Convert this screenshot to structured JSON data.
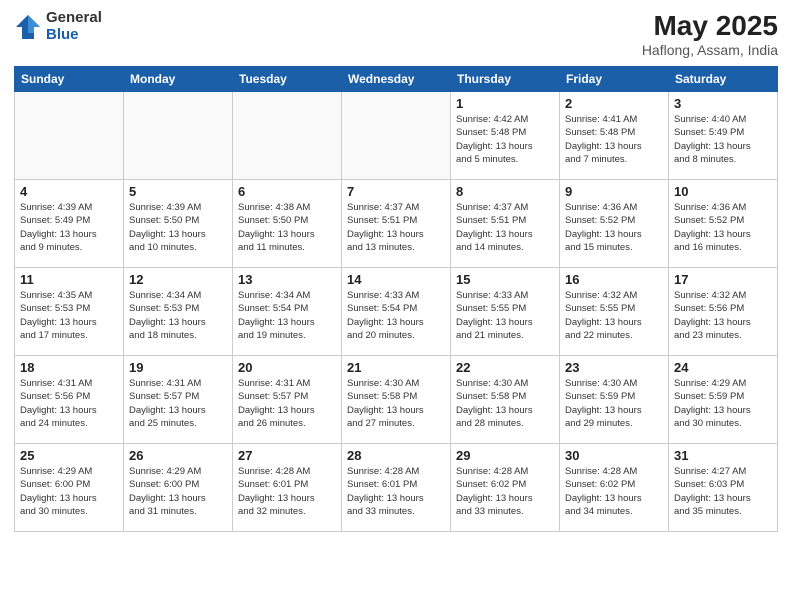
{
  "header": {
    "logo_general": "General",
    "logo_blue": "Blue",
    "title": "May 2025",
    "location": "Haflong, Assam, India"
  },
  "days_of_week": [
    "Sunday",
    "Monday",
    "Tuesday",
    "Wednesday",
    "Thursday",
    "Friday",
    "Saturday"
  ],
  "weeks": [
    [
      {
        "day": "",
        "info": ""
      },
      {
        "day": "",
        "info": ""
      },
      {
        "day": "",
        "info": ""
      },
      {
        "day": "",
        "info": ""
      },
      {
        "day": "1",
        "info": "Sunrise: 4:42 AM\nSunset: 5:48 PM\nDaylight: 13 hours\nand 5 minutes."
      },
      {
        "day": "2",
        "info": "Sunrise: 4:41 AM\nSunset: 5:48 PM\nDaylight: 13 hours\nand 7 minutes."
      },
      {
        "day": "3",
        "info": "Sunrise: 4:40 AM\nSunset: 5:49 PM\nDaylight: 13 hours\nand 8 minutes."
      }
    ],
    [
      {
        "day": "4",
        "info": "Sunrise: 4:39 AM\nSunset: 5:49 PM\nDaylight: 13 hours\nand 9 minutes."
      },
      {
        "day": "5",
        "info": "Sunrise: 4:39 AM\nSunset: 5:50 PM\nDaylight: 13 hours\nand 10 minutes."
      },
      {
        "day": "6",
        "info": "Sunrise: 4:38 AM\nSunset: 5:50 PM\nDaylight: 13 hours\nand 11 minutes."
      },
      {
        "day": "7",
        "info": "Sunrise: 4:37 AM\nSunset: 5:51 PM\nDaylight: 13 hours\nand 13 minutes."
      },
      {
        "day": "8",
        "info": "Sunrise: 4:37 AM\nSunset: 5:51 PM\nDaylight: 13 hours\nand 14 minutes."
      },
      {
        "day": "9",
        "info": "Sunrise: 4:36 AM\nSunset: 5:52 PM\nDaylight: 13 hours\nand 15 minutes."
      },
      {
        "day": "10",
        "info": "Sunrise: 4:36 AM\nSunset: 5:52 PM\nDaylight: 13 hours\nand 16 minutes."
      }
    ],
    [
      {
        "day": "11",
        "info": "Sunrise: 4:35 AM\nSunset: 5:53 PM\nDaylight: 13 hours\nand 17 minutes."
      },
      {
        "day": "12",
        "info": "Sunrise: 4:34 AM\nSunset: 5:53 PM\nDaylight: 13 hours\nand 18 minutes."
      },
      {
        "day": "13",
        "info": "Sunrise: 4:34 AM\nSunset: 5:54 PM\nDaylight: 13 hours\nand 19 minutes."
      },
      {
        "day": "14",
        "info": "Sunrise: 4:33 AM\nSunset: 5:54 PM\nDaylight: 13 hours\nand 20 minutes."
      },
      {
        "day": "15",
        "info": "Sunrise: 4:33 AM\nSunset: 5:55 PM\nDaylight: 13 hours\nand 21 minutes."
      },
      {
        "day": "16",
        "info": "Sunrise: 4:32 AM\nSunset: 5:55 PM\nDaylight: 13 hours\nand 22 minutes."
      },
      {
        "day": "17",
        "info": "Sunrise: 4:32 AM\nSunset: 5:56 PM\nDaylight: 13 hours\nand 23 minutes."
      }
    ],
    [
      {
        "day": "18",
        "info": "Sunrise: 4:31 AM\nSunset: 5:56 PM\nDaylight: 13 hours\nand 24 minutes."
      },
      {
        "day": "19",
        "info": "Sunrise: 4:31 AM\nSunset: 5:57 PM\nDaylight: 13 hours\nand 25 minutes."
      },
      {
        "day": "20",
        "info": "Sunrise: 4:31 AM\nSunset: 5:57 PM\nDaylight: 13 hours\nand 26 minutes."
      },
      {
        "day": "21",
        "info": "Sunrise: 4:30 AM\nSunset: 5:58 PM\nDaylight: 13 hours\nand 27 minutes."
      },
      {
        "day": "22",
        "info": "Sunrise: 4:30 AM\nSunset: 5:58 PM\nDaylight: 13 hours\nand 28 minutes."
      },
      {
        "day": "23",
        "info": "Sunrise: 4:30 AM\nSunset: 5:59 PM\nDaylight: 13 hours\nand 29 minutes."
      },
      {
        "day": "24",
        "info": "Sunrise: 4:29 AM\nSunset: 5:59 PM\nDaylight: 13 hours\nand 30 minutes."
      }
    ],
    [
      {
        "day": "25",
        "info": "Sunrise: 4:29 AM\nSunset: 6:00 PM\nDaylight: 13 hours\nand 30 minutes."
      },
      {
        "day": "26",
        "info": "Sunrise: 4:29 AM\nSunset: 6:00 PM\nDaylight: 13 hours\nand 31 minutes."
      },
      {
        "day": "27",
        "info": "Sunrise: 4:28 AM\nSunset: 6:01 PM\nDaylight: 13 hours\nand 32 minutes."
      },
      {
        "day": "28",
        "info": "Sunrise: 4:28 AM\nSunset: 6:01 PM\nDaylight: 13 hours\nand 33 minutes."
      },
      {
        "day": "29",
        "info": "Sunrise: 4:28 AM\nSunset: 6:02 PM\nDaylight: 13 hours\nand 33 minutes."
      },
      {
        "day": "30",
        "info": "Sunrise: 4:28 AM\nSunset: 6:02 PM\nDaylight: 13 hours\nand 34 minutes."
      },
      {
        "day": "31",
        "info": "Sunrise: 4:27 AM\nSunset: 6:03 PM\nDaylight: 13 hours\nand 35 minutes."
      }
    ]
  ]
}
